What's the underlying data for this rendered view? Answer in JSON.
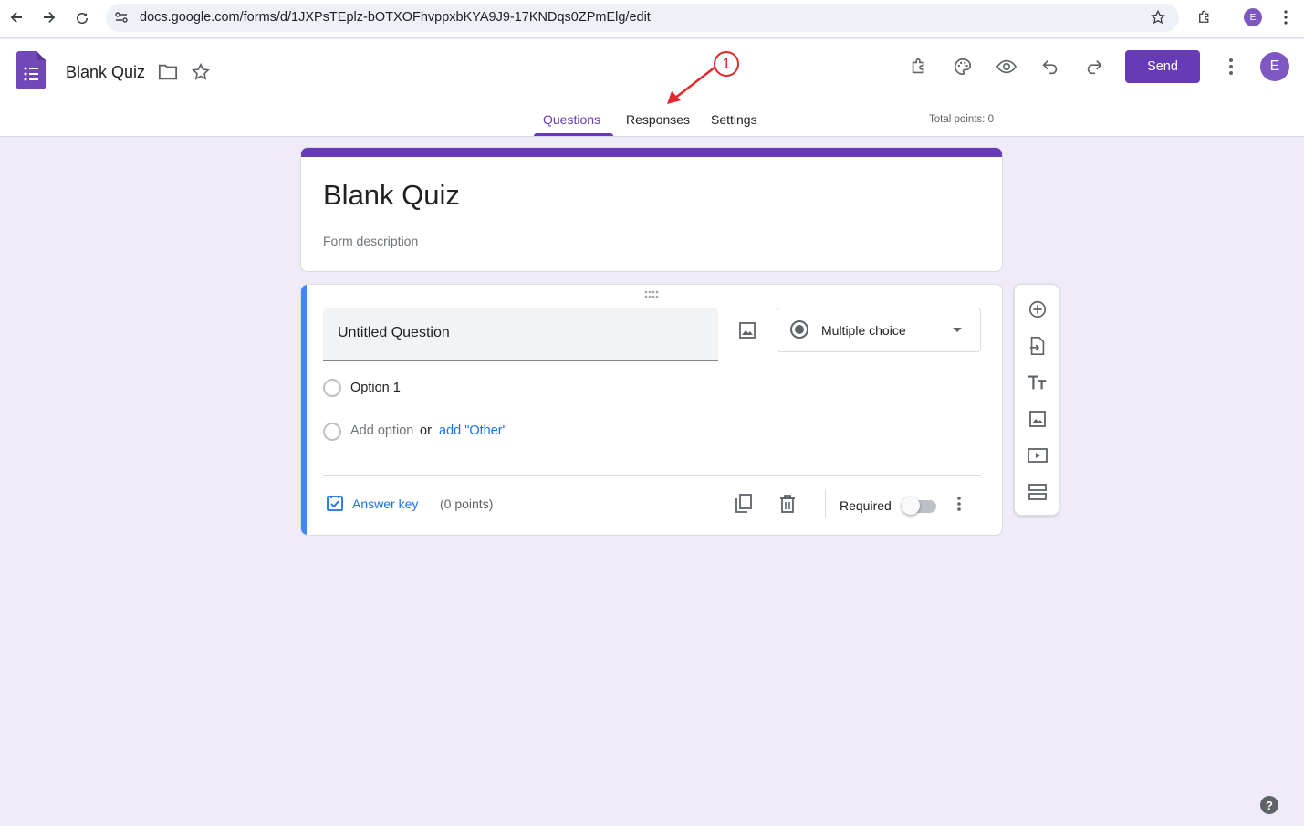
{
  "browser": {
    "url": "docs.google.com/forms/d/1JXPsTEplz-bOTXOFhvppxbKYA9J9-17KNDqs0ZPmElg/edit",
    "profile_initial": "E"
  },
  "header": {
    "doc_title": "Blank Quiz",
    "send_label": "Send",
    "user_initial": "E",
    "total_points": "Total points: 0"
  },
  "tabs": [
    {
      "label": "Questions",
      "active": true
    },
    {
      "label": "Responses",
      "active": false
    },
    {
      "label": "Settings",
      "active": false
    }
  ],
  "annotation": {
    "step": "1"
  },
  "form": {
    "title": "Blank Quiz",
    "description": "Form description"
  },
  "question": {
    "title": "Untitled Question",
    "type": "Multiple choice",
    "options": [
      "Option 1"
    ],
    "add_option": "Add option",
    "or": "or",
    "add_other": "add \"Other\"",
    "answer_key": "Answer key",
    "points": "(0 points)",
    "required_label": "Required",
    "required": false
  },
  "colors": {
    "accent": "#673ab7",
    "background": "#f0ebf8",
    "question_bar": "#4285f4",
    "link": "#1a73e8",
    "annotation": "#e5262b"
  }
}
